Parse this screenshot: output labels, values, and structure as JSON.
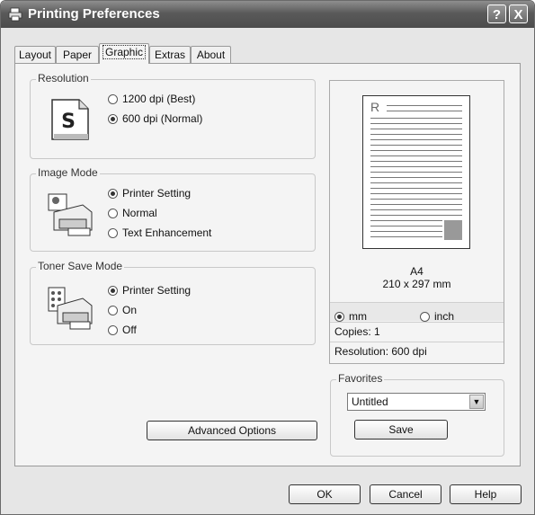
{
  "window": {
    "title": "Printing Preferences",
    "help_glyph": "?",
    "close_glyph": "X"
  },
  "tabs": [
    "Layout",
    "Paper",
    "Graphic",
    "Extras",
    "About"
  ],
  "active_tab": "Graphic",
  "resolution": {
    "label": "Resolution",
    "icon_letter": "S",
    "options": [
      {
        "label": "1200 dpi (Best)",
        "checked": false
      },
      {
        "label": "600 dpi (Normal)",
        "checked": true
      }
    ]
  },
  "image_mode": {
    "label": "Image Mode",
    "options": [
      {
        "label": "Printer Setting",
        "checked": true
      },
      {
        "label": "Normal",
        "checked": false
      },
      {
        "label": "Text Enhancement",
        "checked": false
      }
    ]
  },
  "toner_save": {
    "label": "Toner Save Mode",
    "options": [
      {
        "label": "Printer Setting",
        "checked": true
      },
      {
        "label": "On",
        "checked": false
      },
      {
        "label": "Off",
        "checked": false
      }
    ]
  },
  "advanced_button": "Advanced Options",
  "preview": {
    "page_letter": "R",
    "paper_name": "A4",
    "paper_size": "210 x 297 mm",
    "unit_mm": "mm",
    "unit_inch": "inch",
    "copies": "Copies: 1",
    "resolution": "Resolution: 600 dpi"
  },
  "favorites": {
    "label": "Favorites",
    "selected": "Untitled",
    "save_button": "Save"
  },
  "footer": {
    "ok": "OK",
    "cancel": "Cancel",
    "help": "Help"
  }
}
